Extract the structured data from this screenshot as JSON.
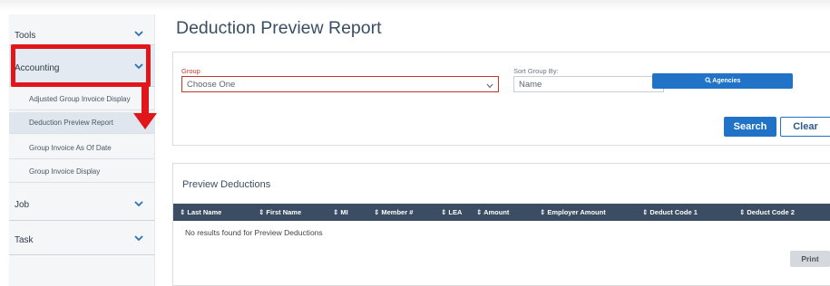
{
  "sidebar": {
    "items": [
      {
        "label": "Tools"
      },
      {
        "label": "Accounting"
      },
      {
        "label": "Job"
      },
      {
        "label": "Task"
      }
    ],
    "accounting_subitems": [
      {
        "label": "Adjusted Group Invoice Display"
      },
      {
        "label": "Deduction Preview Report",
        "active": true
      },
      {
        "label": "Group Invoice As Of Date"
      },
      {
        "label": "Group Invoice Display"
      }
    ]
  },
  "main": {
    "title": "Deduction Preview Report",
    "filters": {
      "group_label": "Group",
      "group_value": "Choose One",
      "sort_label": "Sort Group By:",
      "sort_value": "Name",
      "agencies_button": "Agencies",
      "search_button": "Search",
      "clear_button": "Clear"
    },
    "preview": {
      "title": "Preview Deductions",
      "columns": [
        "Last Name",
        "First Name",
        "MI",
        "Member #",
        "LEA",
        "Amount",
        "Employer Amount",
        "Deduct Code 1",
        "Deduct Code 2"
      ],
      "empty_message": "No results found for Preview Deductions",
      "print_button": "Print"
    }
  },
  "colors": {
    "accent": "#2173c7",
    "table_header": "#3a4d63",
    "highlight": "#e0161b",
    "error_border": "#c0392b",
    "error_label": "#c0392b"
  },
  "icons": {
    "chevron": "chevron-down-icon",
    "sort": "sort-icon",
    "search": "search-icon"
  }
}
